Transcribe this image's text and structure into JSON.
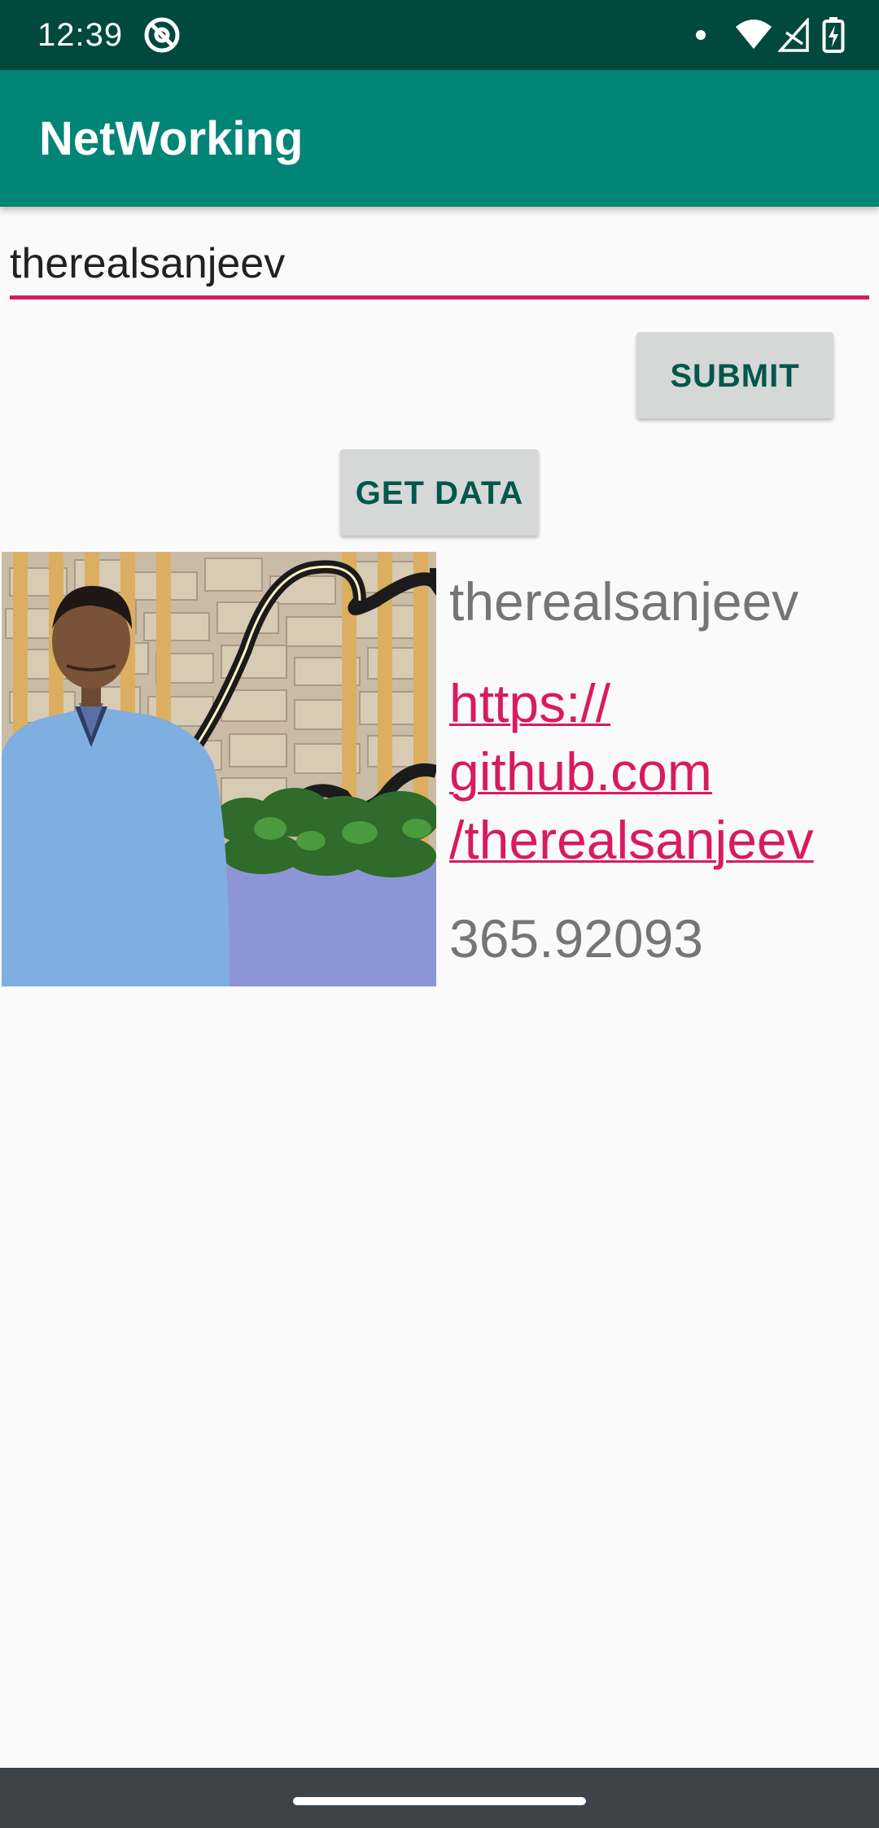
{
  "status_bar": {
    "time": "12:39",
    "icons": [
      "app-notification-icon",
      "dot-icon",
      "wifi-icon",
      "cell-signal-icon",
      "battery-charging-icon"
    ]
  },
  "app_bar": {
    "title": "NetWorking",
    "color": "#008577"
  },
  "form": {
    "username_value": "therealsanjeev",
    "submit_label": "SUBMIT",
    "get_data_label": "GET DATA"
  },
  "profile": {
    "name": "therealsanjeev",
    "url_lines": [
      "https://",
      "github.com",
      "/therealsanjeev"
    ],
    "score": "365.92093"
  },
  "colors": {
    "status_bar": "#01483f",
    "accent": "#d81b60",
    "button_text": "#00574b"
  }
}
